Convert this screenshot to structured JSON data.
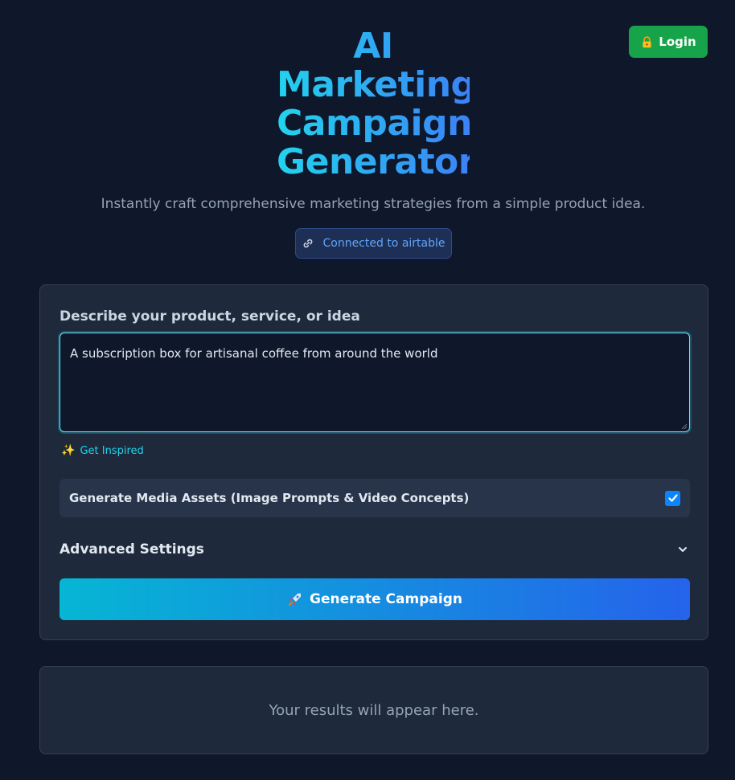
{
  "header": {
    "title_lines": [
      "AI",
      "Marketing",
      "Campaign",
      "Generator"
    ],
    "subtitle": "Instantly craft comprehensive marketing strategies from a simple product idea.",
    "login_label": "Login",
    "connection_status": "Connected to airtable"
  },
  "form": {
    "field_label": "Describe your product, service, or idea",
    "idea_value": "A subscription box for artisanal coffee from around the world",
    "inspire_label": "Get Inspired",
    "media_label": "Generate Media Assets (Image Prompts & Video Concepts)",
    "media_checked": true,
    "advanced_label": "Advanced Settings",
    "generate_label": "Generate Campaign"
  },
  "results": {
    "placeholder": "Your results will appear here."
  },
  "colors": {
    "background": "#0f172a",
    "card": "#1e293b",
    "login_green": "#16a34a",
    "accent_cyan": "#22d3ee",
    "accent_blue": "#2563eb"
  },
  "icons": {
    "login": "lock-icon",
    "connection": "link-icon",
    "inspire": "sparkles-icon",
    "checkbox": "checkmark-icon",
    "advanced": "chevron-down-icon",
    "generate": "rocket-icon"
  }
}
